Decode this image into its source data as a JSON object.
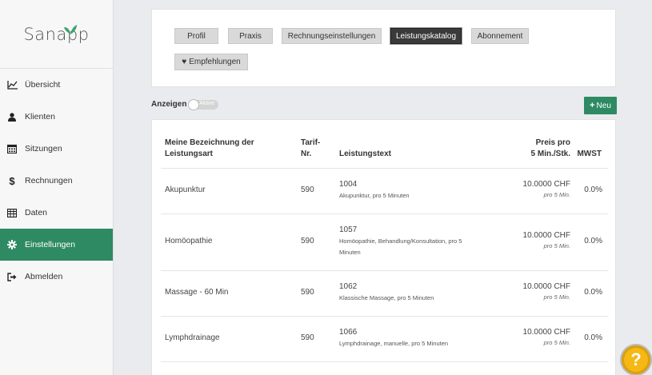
{
  "brand": {
    "name": "Sanapp",
    "leaf_color": "#3fa36a"
  },
  "sidebar": {
    "items": [
      {
        "label": "Übersicht",
        "icon": "line-chart-icon",
        "active": false
      },
      {
        "label": "Klienten",
        "icon": "user-icon",
        "active": false
      },
      {
        "label": "Sitzungen",
        "icon": "calendar-icon",
        "active": false
      },
      {
        "label": "Rechnungen",
        "icon": "dollar-icon",
        "active": false
      },
      {
        "label": "Daten",
        "icon": "table-icon",
        "active": false
      },
      {
        "label": "Einstellungen",
        "icon": "gear-icon",
        "active": true
      },
      {
        "label": "Abmelden",
        "icon": "sign-out-icon",
        "active": false
      }
    ],
    "active_color": "#2e8a63"
  },
  "tabs": [
    {
      "label": "Profil",
      "active": false
    },
    {
      "label": "Praxis",
      "active": false
    },
    {
      "label": "Rechnungseinstellungen",
      "active": false
    },
    {
      "label": "Leistungskatalog",
      "active": true
    },
    {
      "label": "Abonnement",
      "active": false
    },
    {
      "label": "Empfehlungen",
      "active": false,
      "icon": "heart-icon"
    }
  ],
  "filter": {
    "label": "Anzeigen",
    "toggle_label": "Aktive"
  },
  "new_button": {
    "label": "Neu",
    "icon": "plus-icon"
  },
  "table": {
    "headers": {
      "name_line1": "Meine Bezeichnung der",
      "name_line2": "Leistungsart",
      "tarif_line1": "Tarif-",
      "tarif_line2": "Nr.",
      "text": "Leistungstext",
      "price_line1": "Preis pro",
      "price_line2": "5 Min./Stk.",
      "vat": "MWST"
    },
    "rows": [
      {
        "name": "Akupunktur",
        "tarif": "590",
        "code": "1004",
        "desc1": "Akupunktur, pro 5 Minuten",
        "desc2": "",
        "price": "10.0000 CHF",
        "unit": "pro 5 Min.",
        "vat": "0.0%"
      },
      {
        "name": "Homöopathie",
        "tarif": "590",
        "code": "1057",
        "desc1": "Homöopathie, Behandlung/Konsultation, pro 5",
        "desc2": "Minuten",
        "price": "10.0000 CHF",
        "unit": "pro 5 Min.",
        "vat": "0.0%"
      },
      {
        "name": "Massage - 60 Min",
        "tarif": "590",
        "code": "1062",
        "desc1": "Klassische Massage, pro 5 Minuten",
        "desc2": "",
        "price": "10.0000 CHF",
        "unit": "pro 5 Min.",
        "vat": "0.0%"
      },
      {
        "name": "Lymphdrainage",
        "tarif": "590",
        "code": "1066",
        "desc1": "Lymphdrainage, manuelle, pro 5 Minuten",
        "desc2": "",
        "price": "10.0000 CHF",
        "unit": "pro 5 Min.",
        "vat": "0.0%"
      }
    ]
  },
  "help": {
    "label": "?",
    "color": "#f5b814"
  }
}
